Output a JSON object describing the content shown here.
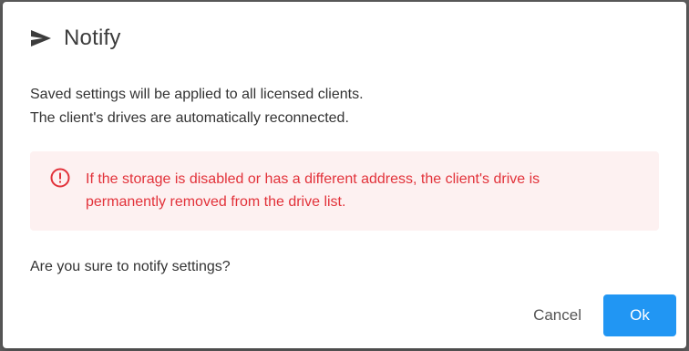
{
  "dialog": {
    "title": "Notify",
    "title_icon": "send-icon",
    "message_line1": "Saved settings will be applied to all licensed clients.",
    "message_line2": "The client's drives are automatically reconnected.",
    "alert": {
      "icon": "error-circle-icon",
      "line1": "If the storage is disabled or has a different address, the client's drive is",
      "line2": "permanently removed from the drive list.",
      "text_color": "#e2323a",
      "background_color": "#fdf1f1"
    },
    "question": "Are you sure to notify settings?",
    "buttons": {
      "cancel_label": "Cancel",
      "ok_label": "Ok",
      "ok_color": "#2196f3"
    }
  }
}
